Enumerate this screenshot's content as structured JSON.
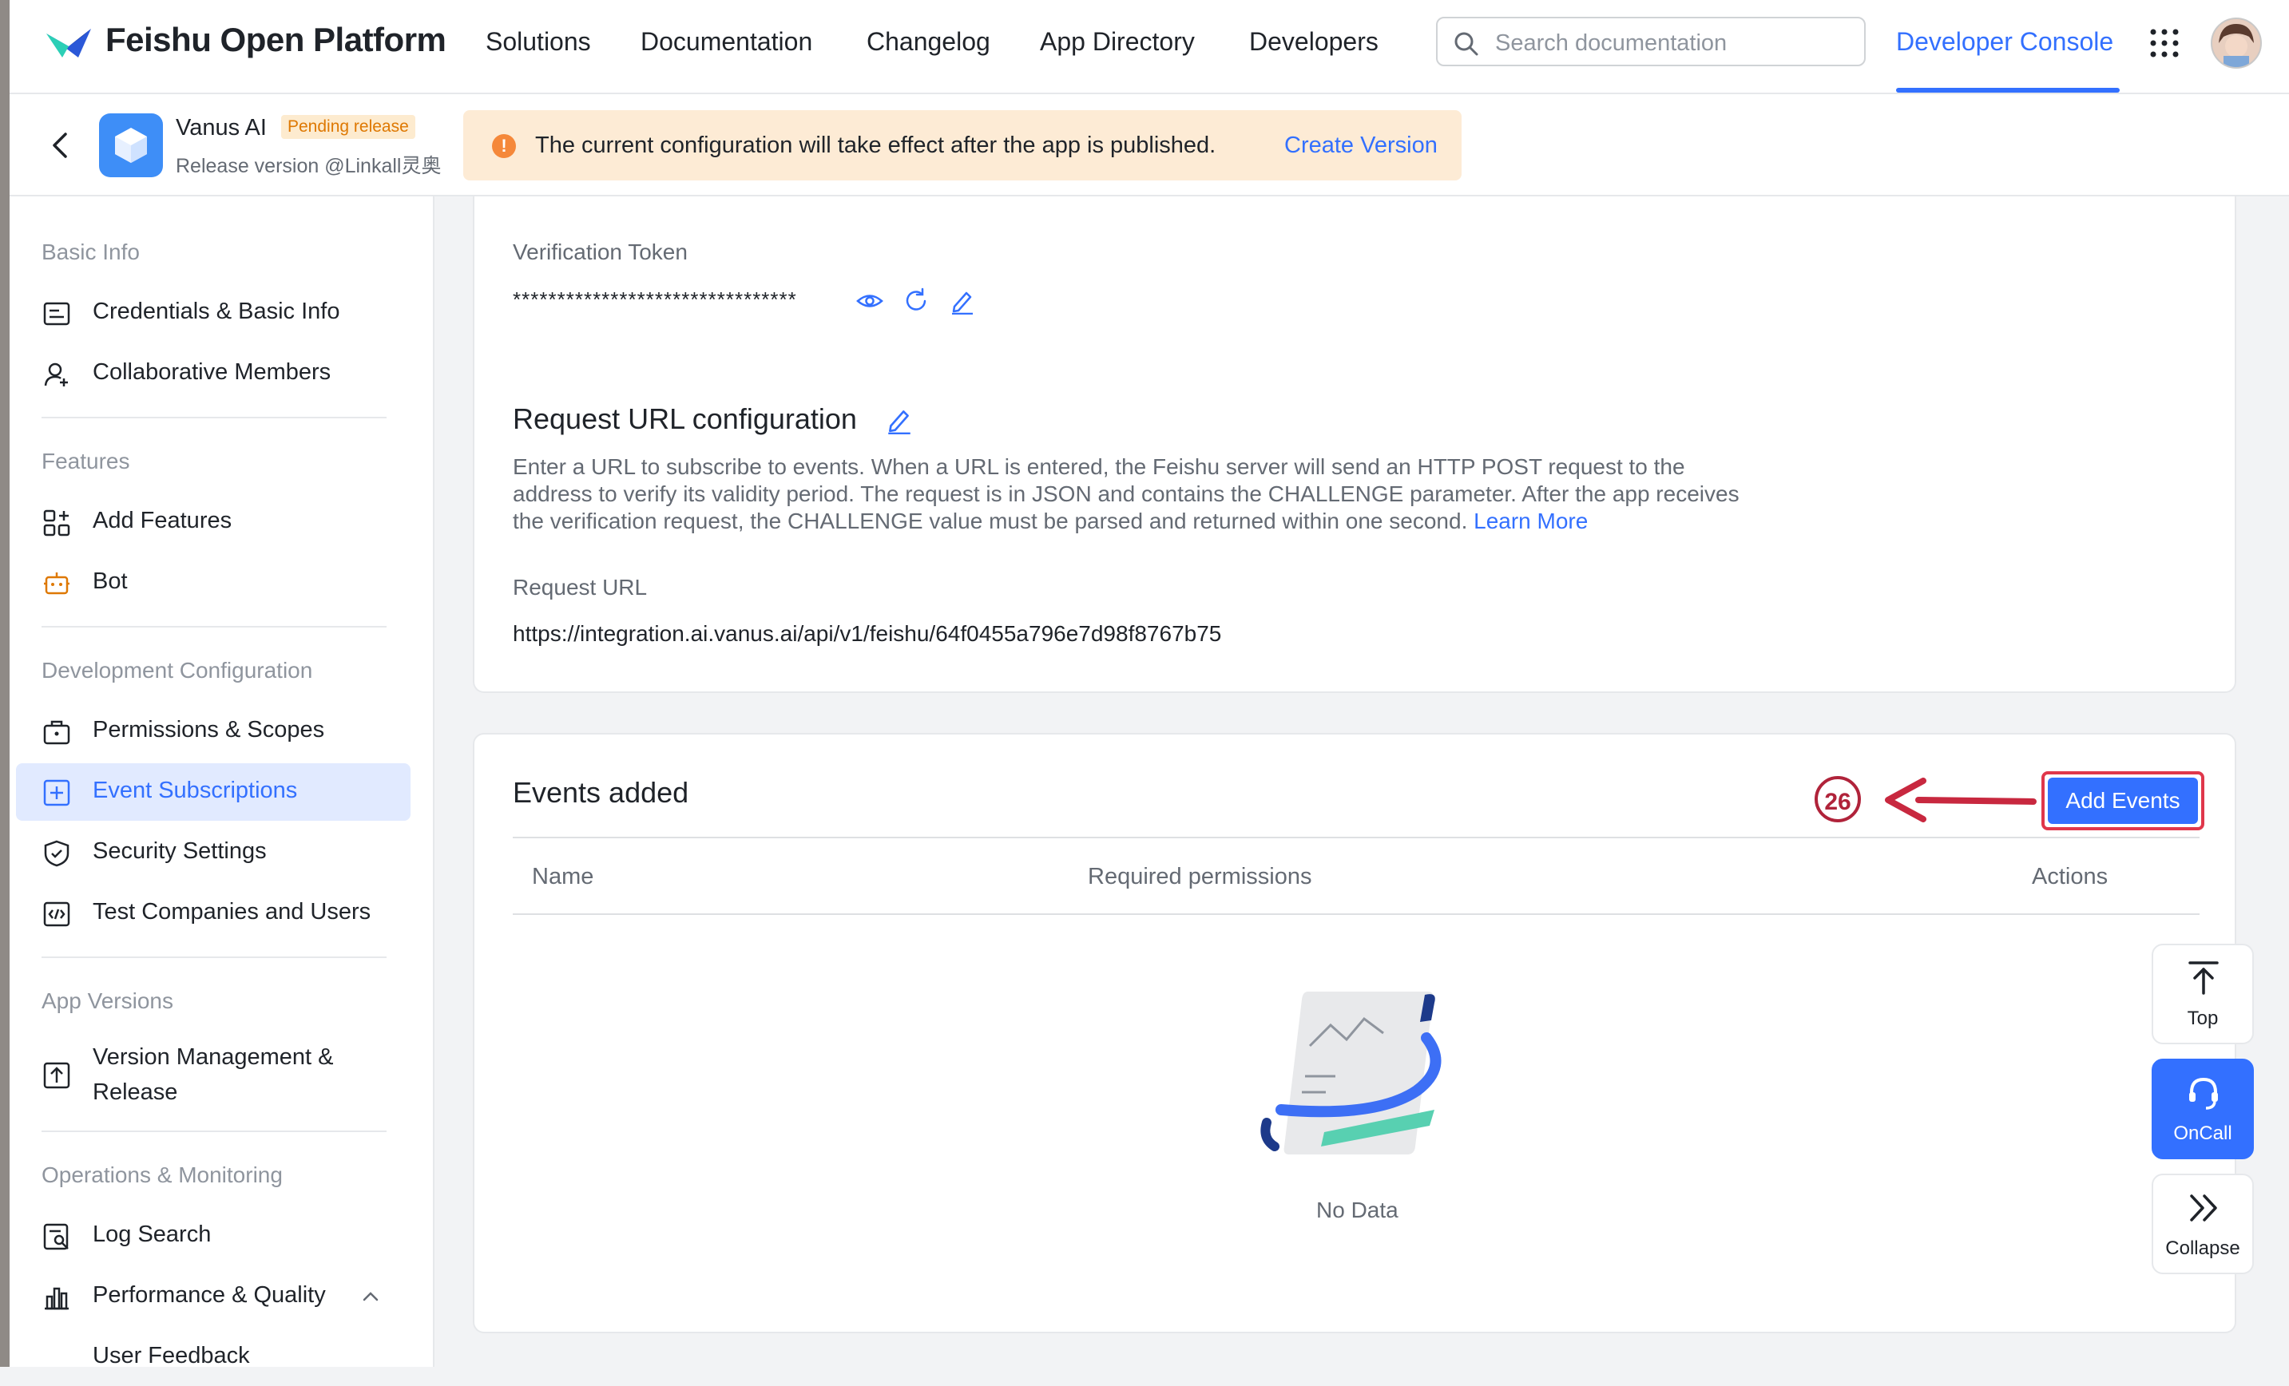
{
  "brand": {
    "name": "Feishu Open Platform",
    "accent": "#3370ff"
  },
  "topnav": {
    "links": [
      "Solutions",
      "Documentation",
      "Changelog",
      "App Directory",
      "Developers"
    ],
    "search_placeholder": "Search documentation",
    "console_label": "Developer Console",
    "icons": [
      "search-icon",
      "apps-grid-icon",
      "avatar"
    ]
  },
  "app": {
    "name": "Vanus AI",
    "badge": "Pending release",
    "release_version": "Release version @Linkall灵奥",
    "notice": "The current configuration will take effect after the app is published.",
    "notice_action": "Create Version"
  },
  "sidebar": {
    "sections": [
      {
        "title": "Basic Info",
        "items": [
          {
            "label": "Credentials & Basic Info",
            "icon": "id-card-icon"
          },
          {
            "label": "Collaborative Members",
            "icon": "add-member-icon"
          }
        ]
      },
      {
        "title": "Features",
        "items": [
          {
            "label": "Add Features",
            "icon": "apps-add-icon"
          },
          {
            "label": "Bot",
            "icon": "robot-icon"
          }
        ]
      },
      {
        "title": "Development Configuration",
        "items": [
          {
            "label": "Permissions & Scopes",
            "icon": "briefcase-icon"
          },
          {
            "label": "Event Subscriptions",
            "icon": "event-icon",
            "active": true
          },
          {
            "label": "Security Settings",
            "icon": "shield-icon"
          },
          {
            "label": "Test Companies and Users",
            "icon": "code-box-icon"
          }
        ]
      },
      {
        "title": "App Versions",
        "items": [
          {
            "label": "Version Management &",
            "label2": "Release",
            "icon": "upload-icon"
          }
        ]
      },
      {
        "title": "Operations & Monitoring",
        "items": [
          {
            "label": "Log Search",
            "icon": "log-search-icon"
          },
          {
            "label": "Performance & Quality",
            "icon": "bar-chart-icon"
          },
          {
            "label": "User Feedback"
          }
        ]
      }
    ]
  },
  "verification": {
    "label": "Verification Token",
    "value": "********************************"
  },
  "request_config": {
    "title": "Request URL configuration",
    "description_1": "Enter a URL to subscribe to events. When a URL is entered, the Feishu server will send an HTTP POST request to the",
    "description_2": "address to verify its validity period. The request is in JSON and contains the CHALLENGE parameter. After the app receives",
    "description_3": "the verification request, the CHALLENGE value must be parsed and returned within one second.",
    "learn_more": "Learn More",
    "url_label": "Request URL",
    "url_value": "https://integration.ai.vanus.ai/api/v1/feishu/64f0455a796e7d98f8767b75"
  },
  "events": {
    "title": "Events added",
    "add_button": "Add Events",
    "step_marker": "26",
    "columns": [
      "Name",
      "Required permissions",
      "Actions"
    ],
    "rows": [],
    "empty_text": "No Data"
  },
  "float_tools": [
    "Top",
    "OnCall",
    "Collapse"
  ],
  "colors": {
    "notice_bg": "#fdebd5",
    "active_bg": "#e1eaff",
    "annotation": "#c8283f"
  }
}
